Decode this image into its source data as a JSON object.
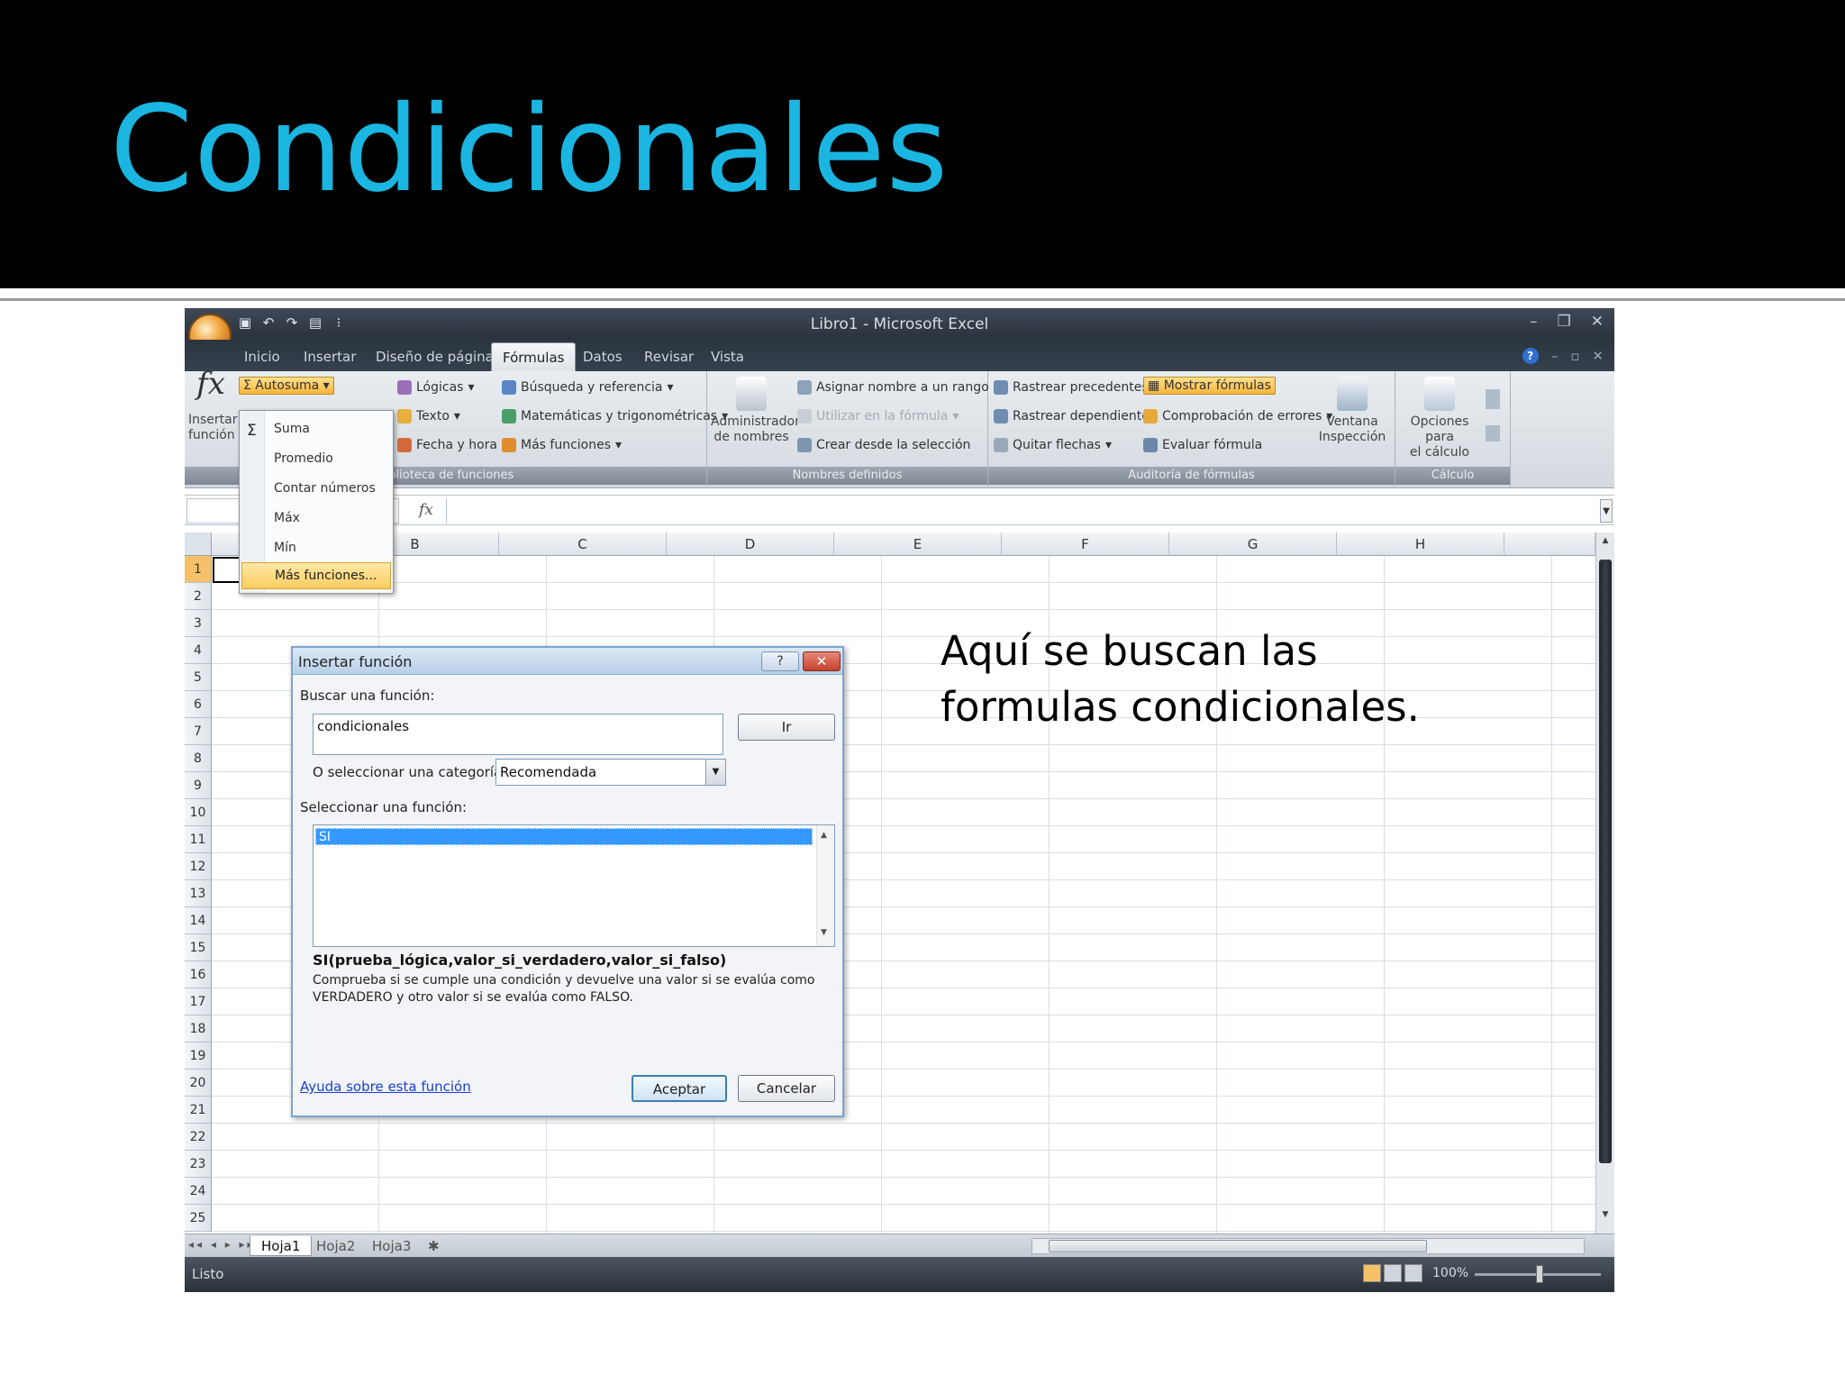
{
  "slide": {
    "title": "Condicionales",
    "annotation_line1": "Aquí se buscan las",
    "annotation_line2": "formulas condicionales."
  },
  "excel": {
    "window_title": "Libro1 - Microsoft Excel",
    "tabs": [
      "Inicio",
      "Insertar",
      "Diseño de página",
      "Fórmulas",
      "Datos",
      "Revisar",
      "Vista"
    ],
    "active_tab": "Fórmulas",
    "ribbon": {
      "insert_function": {
        "line1": "Insertar",
        "line2": "función"
      },
      "autosum": "Autosuma",
      "logicas": "Lógicas",
      "texto": "Texto",
      "fecha_hora": "Fecha y hora",
      "busqueda": "Búsqueda y referencia",
      "matematicas": "Matemáticas y trigonométricas",
      "mas_funciones": "Más funciones",
      "group_biblioteca": "Biblioteca de funciones",
      "admin_nombres": {
        "line1": "Administrador",
        "line2": "de nombres"
      },
      "asignar_nombre": "Asignar nombre a un rango",
      "utilizar_formula": "Utilizar en la fórmula",
      "crear_seleccion": "Crear desde la selección",
      "group_nombres": "Nombres definidos",
      "rastrear_precedentes": "Rastrear precedentes",
      "rastrear_dependientes": "Rastrear dependientes",
      "quitar_flechas": "Quitar flechas",
      "mostrar_formulas": "Mostrar fórmulas",
      "comprobacion_errores": "Comprobación de errores",
      "evaluar_formula": "Evaluar fórmula",
      "ventana_inspeccion": {
        "line1": "Ventana",
        "line2": "Inspección"
      },
      "group_auditoria": "Auditoría de fórmulas",
      "opciones_calculo": {
        "line1": "Opciones para",
        "line2": "el cálculo"
      },
      "group_calculo": "Cálculo"
    },
    "autosum_menu": {
      "items": [
        "Suma",
        "Promedio",
        "Contar números",
        "Máx",
        "Mín"
      ],
      "more": "Más funciones..."
    },
    "fx_symbol": "fx",
    "columns": [
      "B",
      "C",
      "D",
      "E",
      "F",
      "G",
      "H"
    ],
    "rows": [
      "1",
      "2",
      "3",
      "4",
      "5",
      "6",
      "7",
      "8",
      "9",
      "10",
      "11",
      "12",
      "13",
      "14",
      "15",
      "16",
      "17",
      "18",
      "19",
      "20",
      "21",
      "22",
      "23",
      "24",
      "25"
    ],
    "sheet_tabs": [
      "Hoja1",
      "Hoja2",
      "Hoja3"
    ],
    "active_sheet": "Hoja1",
    "status": "Listo",
    "zoom": "100%"
  },
  "dialog": {
    "title": "Insertar función",
    "help_btn": "?",
    "close_btn": "✕",
    "search_label": "Buscar una función:",
    "search_value": "condicionales",
    "go_button": "Ir",
    "category_label": "O seleccionar una categoría:",
    "category_value": "Recomendada",
    "select_label": "Seleccionar una función:",
    "functions": [
      "SI"
    ],
    "selected_function": "SI",
    "syntax": "SI(prueba_lógica,valor_si_verdadero,valor_si_falso)",
    "description": "Comprueba si se cumple una condición y devuelve una valor si se evalúa como VERDADERO y otro valor si se evalúa como FALSO.",
    "help_link": "Ayuda sobre esta función",
    "ok_button": "Aceptar",
    "cancel_button": "Cancelar"
  },
  "colors": {
    "title_accent": "#1ab5e0",
    "selection_blue": "#3399ff",
    "highlight_orange": "#f7c16a"
  }
}
